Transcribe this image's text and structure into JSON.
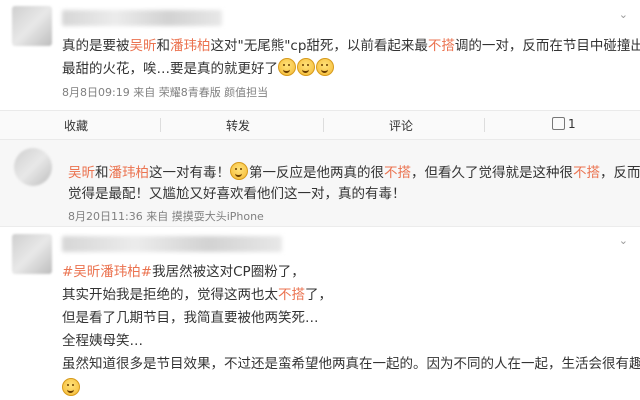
{
  "post1": {
    "line1_parts": [
      "真的是要被",
      "吴昕",
      "和",
      "潘玮柏",
      "这对\"无尾熊\"cp甜死，以前看起来最",
      "不搭",
      "调的一对，反而在节目中碰撞出"
    ],
    "line2": "最甜的火花，唉…要是真的就更好了",
    "meta": "8月8日09:19 来自 荣耀8青春版 颜值担当"
  },
  "actions": {
    "favorite": "收藏",
    "repost": "转发",
    "comment": "评论",
    "like_count": "1"
  },
  "post2": {
    "line1_parts": [
      "吴昕",
      "和",
      "潘玮柏",
      "这一对有毒！",
      "第一反应是他两真的很",
      "不搭",
      "，但看久了觉得就是这种很",
      "不搭",
      "，反而"
    ],
    "line2": "觉得是最配！又尴尬又好喜欢看他们这一对，真的有毒！",
    "meta": "8月20日11:36 来自 摸摸耍大头iPhone"
  },
  "post3": {
    "line1_parts": [
      "#吴昕潘玮柏#",
      "我居然被这对CP圈粉了，"
    ],
    "line2_parts": [
      "其实开始我是拒绝的，觉得这两也太",
      "不搭",
      "了，"
    ],
    "line3": "但是看了几期节目，我简直要被他两笑死…",
    "line4": "全程姨母笑…",
    "line5": "虽然知道很多是节目效果，不过还是蛮希望他两真在一起的。因为不同的人在一起，生活会很有趣"
  },
  "colors": {
    "highlight": "#eb7350",
    "meta": "#808080"
  },
  "icons": [
    "chevron-down-icon",
    "smile-emoji-icon",
    "thumbs-up-icon"
  ]
}
